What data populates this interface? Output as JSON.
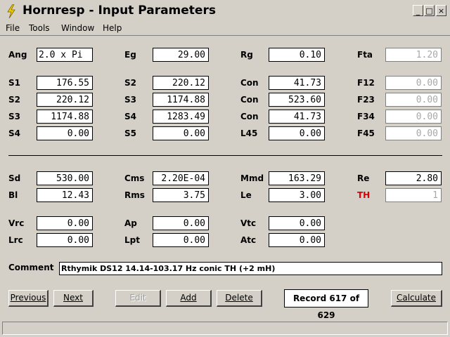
{
  "window": {
    "title": "Hornresp - Input Parameters",
    "minimize": "_",
    "maximize": "□",
    "close": "×"
  },
  "menu": [
    "File",
    "Tools",
    "Window",
    "Help"
  ],
  "fields": {
    "ang": {
      "label": "Ang",
      "value": "2.0 x Pi"
    },
    "eg": {
      "label": "Eg",
      "value": "29.00"
    },
    "rg": {
      "label": "Rg",
      "value": "0.10"
    },
    "fta": {
      "label": "Fta",
      "value": "1.20"
    },
    "s1": {
      "label": "S1",
      "value": "176.55"
    },
    "s2a": {
      "label": "S2",
      "value": "220.12"
    },
    "con1": {
      "label": "Con",
      "value": "41.73"
    },
    "f12": {
      "label": "F12",
      "value": "0.00"
    },
    "s2": {
      "label": "S2",
      "value": "220.12"
    },
    "s3a": {
      "label": "S3",
      "value": "1174.88"
    },
    "con2": {
      "label": "Con",
      "value": "523.60"
    },
    "f23": {
      "label": "F23",
      "value": "0.00"
    },
    "s3": {
      "label": "S3",
      "value": "1174.88"
    },
    "s4a": {
      "label": "S4",
      "value": "1283.49"
    },
    "con3": {
      "label": "Con",
      "value": "41.73"
    },
    "f34": {
      "label": "F34",
      "value": "0.00"
    },
    "s4": {
      "label": "S4",
      "value": "0.00"
    },
    "s5": {
      "label": "S5",
      "value": "0.00"
    },
    "l45": {
      "label": "L45",
      "value": "0.00"
    },
    "f45": {
      "label": "F45",
      "value": "0.00"
    },
    "sd": {
      "label": "Sd",
      "value": "530.00"
    },
    "cms": {
      "label": "Cms",
      "value": "2.20E-04"
    },
    "mmd": {
      "label": "Mmd",
      "value": "163.29"
    },
    "re": {
      "label": "Re",
      "value": "2.80"
    },
    "bl": {
      "label": "Bl",
      "value": "12.43"
    },
    "rms": {
      "label": "Rms",
      "value": "3.75"
    },
    "le": {
      "label": "Le",
      "value": "3.00"
    },
    "th": {
      "label": "TH",
      "value": "1"
    },
    "vrc": {
      "label": "Vrc",
      "value": "0.00"
    },
    "ap": {
      "label": "Ap",
      "value": "0.00"
    },
    "vtc": {
      "label": "Vtc",
      "value": "0.00"
    },
    "lrc": {
      "label": "Lrc",
      "value": "0.00"
    },
    "lpt": {
      "label": "Lpt",
      "value": "0.00"
    },
    "atc": {
      "label": "Atc",
      "value": "0.00"
    }
  },
  "comment": {
    "label": "Comment",
    "value": "Rthymik DS12 14.14-103.17 Hz conic TH (+2 mH)"
  },
  "buttons": {
    "previous": "Previous",
    "next": "Next",
    "edit": "Edit",
    "add": "Add",
    "delete": "Delete",
    "calculate": "Calculate"
  },
  "record": "Record 617 of 629",
  "colors": {
    "background": "#d4d0c8",
    "th_label": "#e00000",
    "disabled_text": "#a8a8a8",
    "icon_yellow": "#f0d000"
  },
  "icons": {
    "app": "lightning-bolt-icon"
  }
}
